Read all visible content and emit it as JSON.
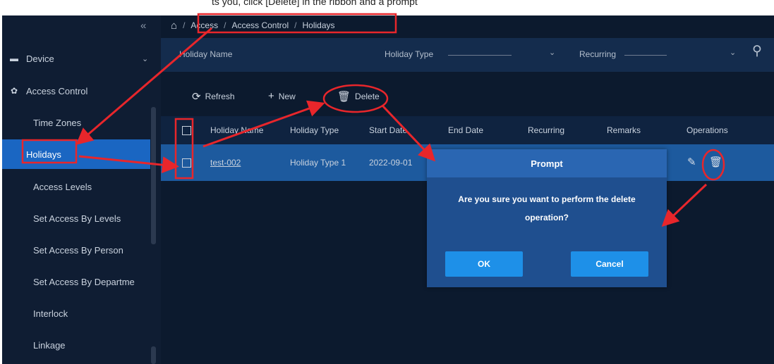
{
  "top_caption": "ts you, click [Delete] in the ribbon and a prompt",
  "sidebar": {
    "collapse_icon": "double-chevron-left-icon",
    "groups": [
      {
        "label": "Device",
        "icon": "device-icon",
        "chevron": "chevron-down-icon"
      },
      {
        "label": "Access Control",
        "icon": "gear-icon",
        "chevron": "chevron-up-icon"
      }
    ],
    "items": [
      {
        "label": "Time Zones"
      },
      {
        "label": "Holidays"
      },
      {
        "label": "Access Levels"
      },
      {
        "label": "Set Access By Levels"
      },
      {
        "label": "Set Access By Person"
      },
      {
        "label": "Set Access By Departme"
      },
      {
        "label": "Interlock"
      },
      {
        "label": "Linkage"
      }
    ],
    "active_index": 1
  },
  "breadcrumb": {
    "home_icon": "home-icon",
    "separator": "/",
    "items": [
      "Access",
      "Access Control",
      "Holidays"
    ]
  },
  "filters": {
    "holiday_name_label": "Holiday Name",
    "holiday_type_label": "Holiday Type",
    "recurring_label": "Recurring",
    "search_icon": "search-icon"
  },
  "toolbar": {
    "refresh_label": "Refresh",
    "new_label": "New",
    "delete_label": "Delete"
  },
  "table": {
    "columns": [
      "Holiday Name",
      "Holiday Type",
      "Start Date",
      "End Date",
      "Recurring",
      "Remarks",
      "Operations"
    ],
    "rows": [
      {
        "holiday_name": "test-002",
        "holiday_type": "Holiday Type 1",
        "start_date": "2022-09-01",
        "end_date": "",
        "recurring": "",
        "remarks": "",
        "operations": [
          "edit-icon",
          "trash-icon"
        ]
      }
    ]
  },
  "dialog": {
    "title": "Prompt",
    "message": "Are you sure you want to perform the delete operation?",
    "ok_label": "OK",
    "cancel_label": "Cancel"
  },
  "colors": {
    "active_nav": "#1a66c2",
    "selected_row": "#1d5a9e",
    "dialog_button": "#1e90e8",
    "annotation": "#e8262b"
  }
}
